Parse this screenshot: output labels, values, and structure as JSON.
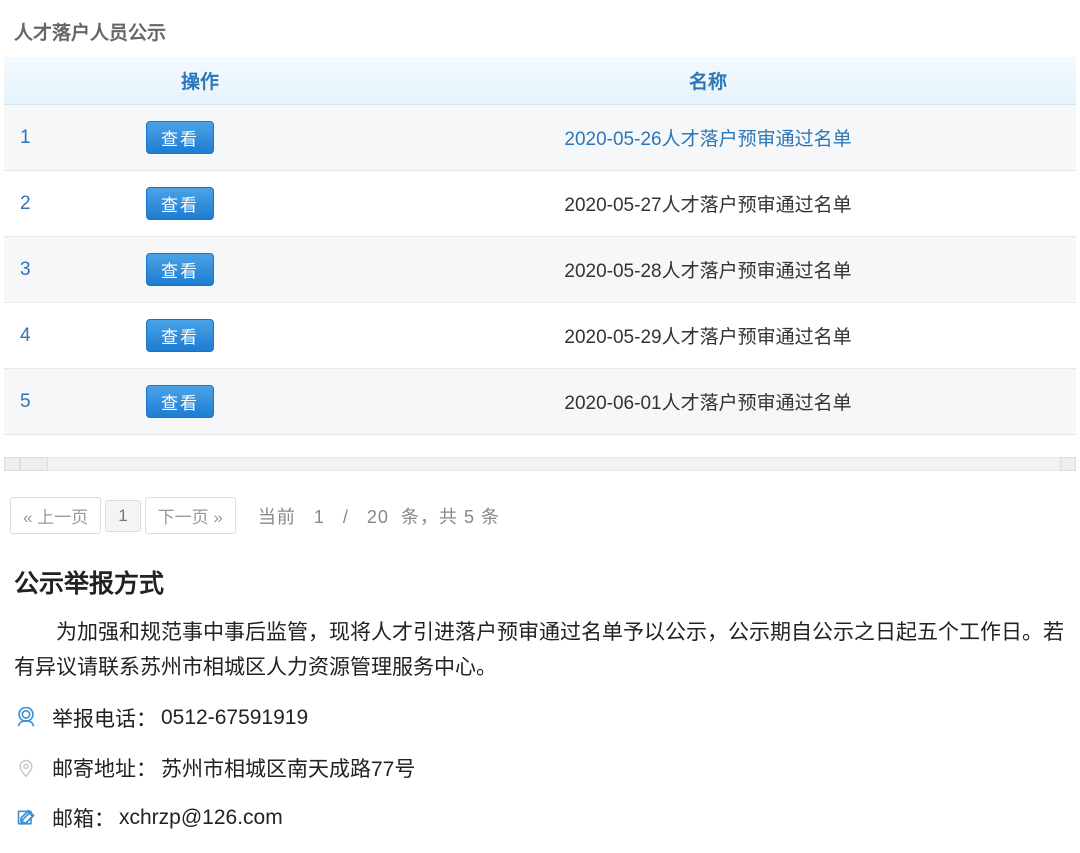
{
  "title": "人才落户人员公示",
  "columns": {
    "op": "操作",
    "name": "名称"
  },
  "view_label": "查看",
  "rows": [
    {
      "idx": "1",
      "title": "2020-05-26人才落户预审通过名单",
      "active": true
    },
    {
      "idx": "2",
      "title": "2020-05-27人才落户预审通过名单",
      "active": false
    },
    {
      "idx": "3",
      "title": "2020-05-28人才落户预审通过名单",
      "active": false
    },
    {
      "idx": "4",
      "title": "2020-05-29人才落户预审通过名单",
      "active": false
    },
    {
      "idx": "5",
      "title": "2020-06-01人才落户预审通过名单",
      "active": false
    }
  ],
  "pagination": {
    "prev": "« 上一页",
    "next": "下一页 »",
    "current": "1",
    "info_prefix": "当前",
    "page": "1",
    "sep": "/",
    "per": "20",
    "unit": "条，",
    "total_prefix": "共",
    "total": "5",
    "total_suffix": "条"
  },
  "report": {
    "heading": "公示举报方式",
    "paragraph": "为加强和规范事中事后监管，现将人才引进落户预审通过名单予以公示，公示期自公示之日起五个工作日。若有异议请联系苏州市相城区人力资源管理服务中心。",
    "phone_label": "举报电话：",
    "phone": "0512-67591919",
    "addr_label": "邮寄地址：",
    "addr": "苏州市相城区南天成路77号",
    "mail_label": "邮箱：",
    "mail": "xchrzp@126.com"
  },
  "colors": {
    "accent": "#3a8fd6"
  }
}
